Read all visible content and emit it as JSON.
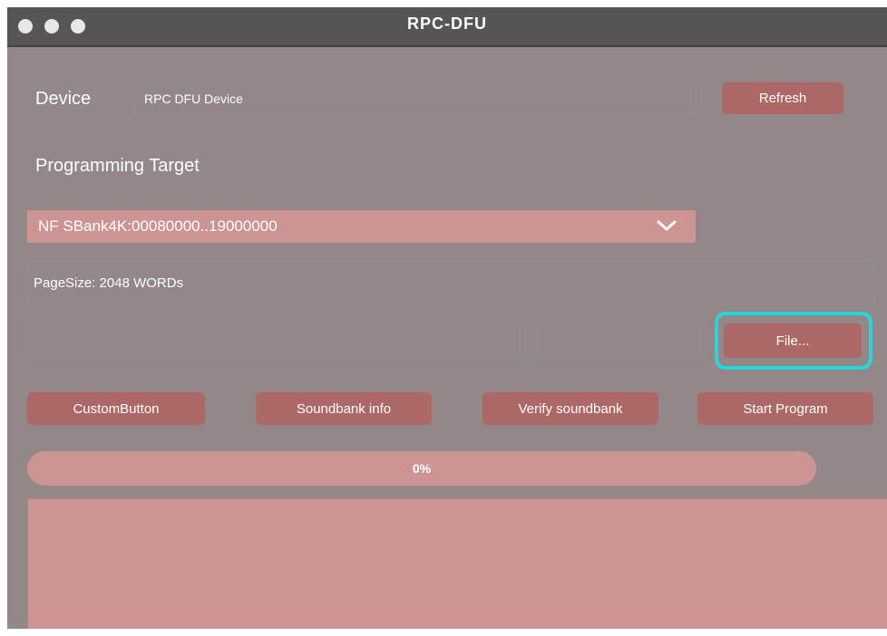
{
  "window": {
    "title": "RPC-DFU"
  },
  "device": {
    "label": "Device",
    "value": "RPC DFU Device",
    "refresh_label": "Refresh"
  },
  "programming": {
    "heading": "Programming Target",
    "selected_target": "NF SBank4K:00080000..19000000",
    "info": "PageSize: 2048 WORDs"
  },
  "file": {
    "path_value": "",
    "aux_value": "",
    "file_button_label": "File..."
  },
  "actions": {
    "custom_label": "CustomButton",
    "soundbank_info_label": "Soundbank info",
    "verify_label": "Verify soundbank",
    "start_label": "Start Program"
  },
  "progress": {
    "text": "0%",
    "value": 0
  },
  "log": {
    "content": ""
  },
  "colors": {
    "window_bg": "#938887",
    "titlebar_bg": "#575555",
    "button": "#ad6865",
    "select": "#cc9593",
    "focus_ring": "#27d6dc"
  }
}
